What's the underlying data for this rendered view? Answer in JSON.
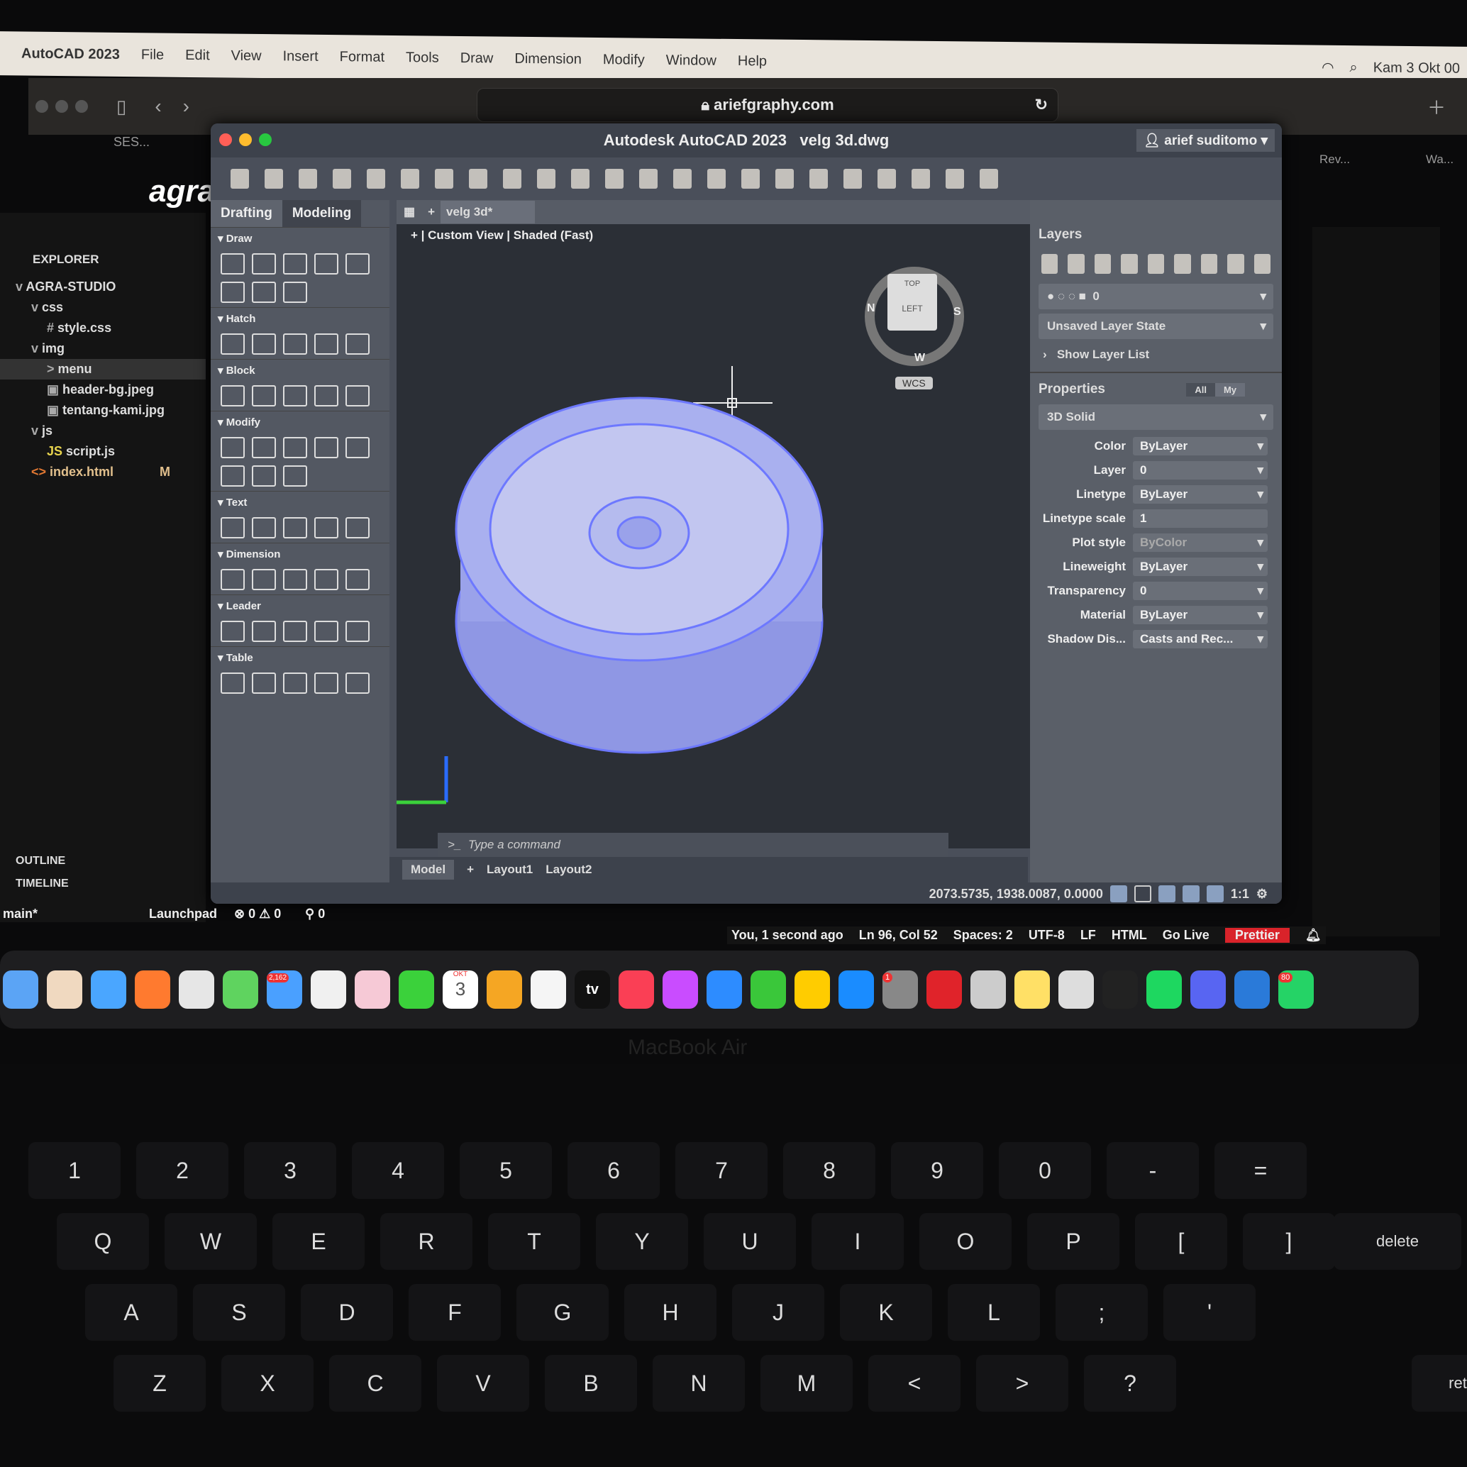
{
  "menubar": {
    "app": "AutoCAD 2023",
    "items": [
      "File",
      "Edit",
      "View",
      "Insert",
      "Format",
      "Tools",
      "Draw",
      "Dimension",
      "Modify",
      "Window",
      "Help"
    ],
    "clock": "Kam 3 Okt  00"
  },
  "safari": {
    "url": "ariefgraphy.com",
    "tab_left": "SES...",
    "tab_right1": "Rev...",
    "tab_right2": "Wa..."
  },
  "vscode": {
    "site_logo": "agra",
    "explorer_title": "EXPLORER",
    "tree": [
      {
        "label": "AGRA-STUDIO",
        "indent": 0,
        "arrow": "v"
      },
      {
        "label": "css",
        "indent": 1,
        "arrow": "v"
      },
      {
        "label": "style.css",
        "indent": 2,
        "icon": "#"
      },
      {
        "label": "img",
        "indent": 1,
        "arrow": "v"
      },
      {
        "label": "menu",
        "indent": 2,
        "arrow": ">"
      },
      {
        "label": "header-bg.jpeg",
        "indent": 2,
        "icon": "▣"
      },
      {
        "label": "tentang-kami.jpg",
        "indent": 2,
        "icon": "▣"
      },
      {
        "label": "js",
        "indent": 1,
        "arrow": "v"
      },
      {
        "label": "script.js",
        "indent": 2,
        "icon": "JS"
      },
      {
        "label": "index.html",
        "indent": 1,
        "icon": "<>",
        "badge": "M"
      }
    ],
    "outline": "OUTLINE",
    "timeline": "TIMELINE",
    "status_left": {
      "branch": "main*",
      "launchpad": "Launchpad",
      "errors": "0",
      "warnings": "0",
      "ports": "0"
    },
    "status_right": {
      "blame": "You, 1 second ago",
      "position": "Ln 96, Col 52",
      "spaces": "Spaces: 2",
      "encoding": "UTF-8",
      "eol": "LF",
      "language": "HTML",
      "golive": "Go Live",
      "prettier": "Prettier"
    }
  },
  "autocad": {
    "title": "Autodesk AutoCAD 2023",
    "filename": "velg 3d.dwg",
    "user": "arief suditomo",
    "workspace_tabs": [
      "Drafting",
      "Modeling"
    ],
    "doc_tab": "velg 3d*",
    "viewport_controls": [
      "Custom View",
      "Shaded (Fast)"
    ],
    "ribbon_sections": [
      "Draw",
      "Hatch",
      "Block",
      "Modify",
      "Text",
      "Dimension",
      "Leader",
      "Table"
    ],
    "viewcube": {
      "face": "LEFT",
      "top": "TOP",
      "compass": [
        "N",
        "S",
        "W"
      ],
      "ucs": "WCS"
    },
    "command_placeholder": "Type a command",
    "layout_tabs": [
      "Model",
      "Layout1",
      "Layout2"
    ],
    "coordinates": "2073.5735, 1938.0087, 0.0000",
    "scale": "1:1",
    "layers": {
      "title": "Layers",
      "current_layer": "0",
      "layer_state": "Unsaved Layer State",
      "show_list": "Show Layer List"
    },
    "properties": {
      "title": "Properties",
      "filter_all": "All",
      "filter_my": "My",
      "object_type": "3D Solid",
      "rows": [
        {
          "label": "Color",
          "value": "ByLayer"
        },
        {
          "label": "Layer",
          "value": "0"
        },
        {
          "label": "Linetype",
          "value": "ByLayer"
        },
        {
          "label": "Linetype scale",
          "value": "1"
        },
        {
          "label": "Plot style",
          "value": "ByColor"
        },
        {
          "label": "Lineweight",
          "value": "ByLayer"
        },
        {
          "label": "Transparency",
          "value": "0"
        },
        {
          "label": "Material",
          "value": "ByLayer"
        },
        {
          "label": "Shadow Dis...",
          "value": "Casts and Rec..."
        }
      ]
    },
    "model_color": "#7f8cff"
  },
  "dock": {
    "mail_badge": "2,162",
    "calendar_month": "OKT",
    "calendar_day": "3",
    "tv": "tv",
    "settings_badge": "1",
    "whatsapp_badge": "80"
  },
  "laptop": {
    "brand": "MacBook Air"
  },
  "keyboard": {
    "rows": [
      [
        "1",
        "2",
        "3",
        "4",
        "5",
        "6",
        "7",
        "8",
        "9",
        "0",
        "-",
        "="
      ],
      [
        "Q",
        "W",
        "E",
        "R",
        "T",
        "Y",
        "U",
        "I",
        "O",
        "P",
        "[",
        "]"
      ],
      [
        "A",
        "S",
        "D",
        "F",
        "G",
        "H",
        "J",
        "K",
        "L",
        ";",
        "'"
      ],
      [
        "Z",
        "X",
        "C",
        "V",
        "B",
        "N",
        "M",
        "<",
        ">",
        "?"
      ]
    ],
    "delete": "delete",
    "return": "ret"
  }
}
